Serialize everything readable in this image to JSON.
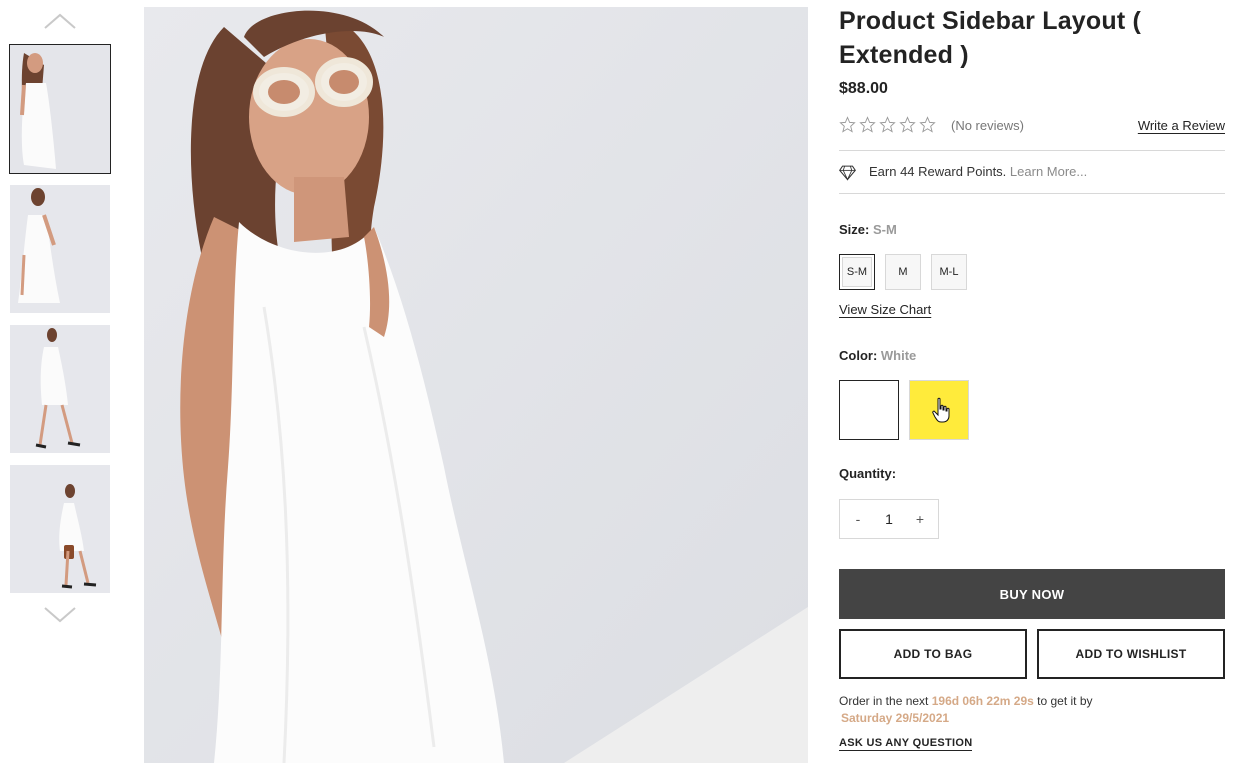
{
  "product": {
    "title": "Product Sidebar Layout ( Extended )",
    "price": "$88.00",
    "rating_stars": 0,
    "rating_max": 5,
    "reviews_text": "(No reviews)",
    "write_review_label": "Write a Review"
  },
  "rewards": {
    "icon": "diamond-icon",
    "text": "Earn 44 Reward Points.",
    "link_label": "Learn More..."
  },
  "size": {
    "label": "Size:",
    "selected": "S-M",
    "options": [
      "S-M",
      "M",
      "M-L"
    ],
    "chart_link": "View Size Chart"
  },
  "color": {
    "label": "Color:",
    "selected": "White",
    "swatches": [
      {
        "name": "White",
        "hex": "#ffffff"
      },
      {
        "name": "Yellow",
        "hex": "#ffeb3b"
      }
    ]
  },
  "quantity": {
    "label": "Quantity:",
    "value": "1",
    "minus": "-",
    "plus": "+"
  },
  "actions": {
    "buy_now": "BUY NOW",
    "add_to_bag": "ADD TO BAG",
    "add_to_wishlist": "ADD TO WISHLIST"
  },
  "order": {
    "prefix": "Order in the next",
    "countdown": "196d 06h 22m 29s",
    "middle": "to get it by",
    "date": "Saturday 29/5/2021"
  },
  "ask_question": "ASK US ANY QUESTION",
  "gallery": {
    "thumbnail_count": 4,
    "active_thumbnail": 1,
    "up_icon": "chevron-up-icon",
    "down_icon": "chevron-down-icon"
  },
  "colors": {
    "text": "#232323",
    "muted": "#777777",
    "accent": "#d5a987",
    "button_dark": "#444444",
    "swatch_yellow": "#ffeb3b",
    "image_bg": "#e4e5e9"
  }
}
